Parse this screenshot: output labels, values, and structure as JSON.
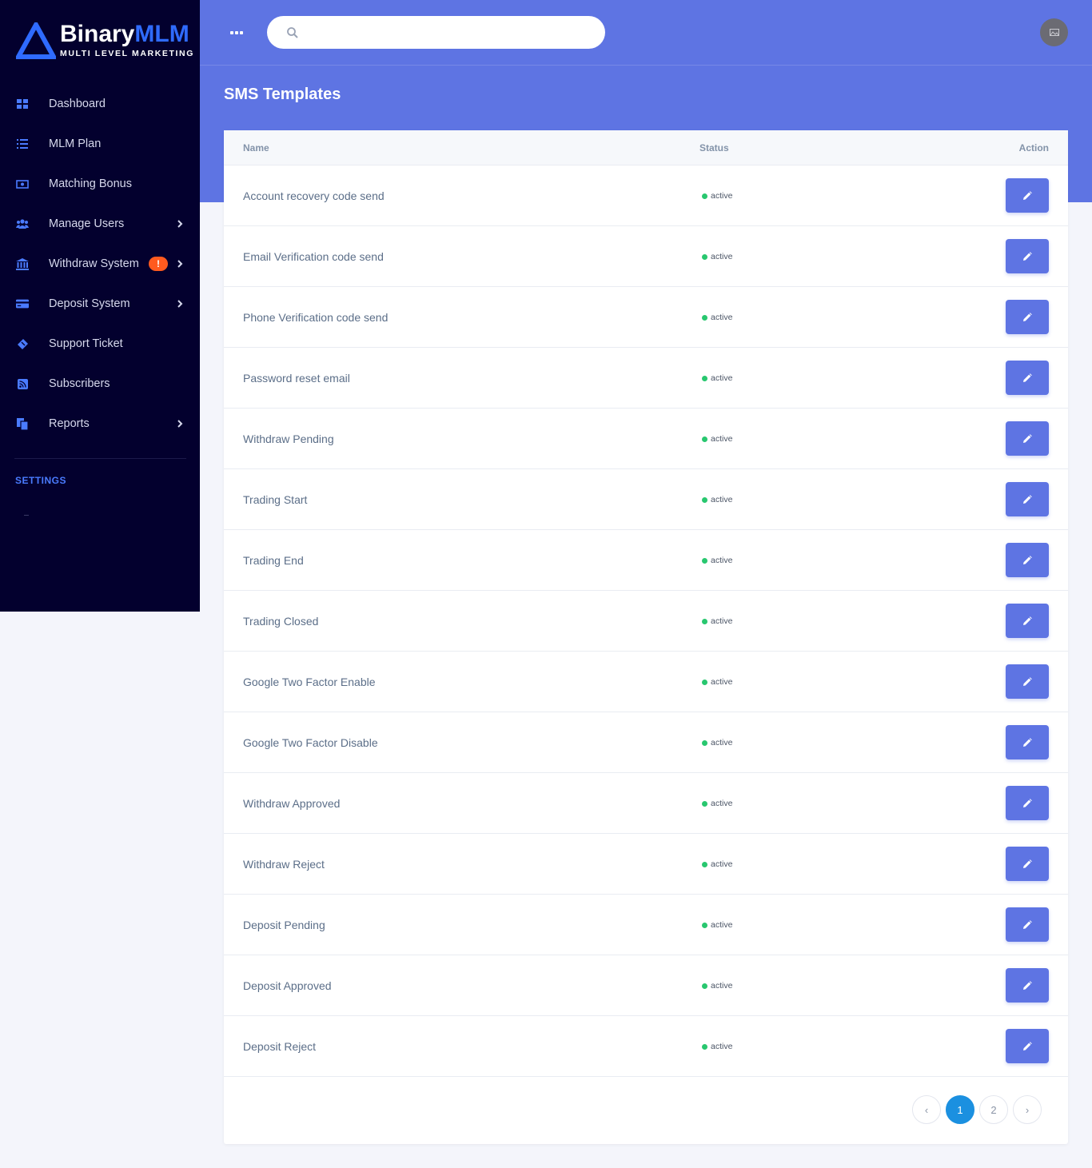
{
  "brand": {
    "name_part1": "Binary",
    "name_part2": "MLM",
    "tagline": "MULTI LEVEL MARKETING",
    "accent": "#2f6bff"
  },
  "sidebar": {
    "items": [
      {
        "label": "Dashboard",
        "icon": "grid-icon",
        "has_arrow": false
      },
      {
        "label": "MLM Plan",
        "icon": "list-icon",
        "has_arrow": false
      },
      {
        "label": "Matching Bonus",
        "icon": "money-icon",
        "has_arrow": false
      },
      {
        "label": "Manage Users",
        "icon": "users-icon",
        "has_arrow": true
      },
      {
        "label": "Withdraw System",
        "icon": "bank-icon",
        "has_arrow": true,
        "badge": "!"
      },
      {
        "label": "Deposit System",
        "icon": "credit-card-icon",
        "has_arrow": true
      },
      {
        "label": "Support Ticket",
        "icon": "ticket-icon",
        "has_arrow": false
      },
      {
        "label": "Subscribers",
        "icon": "rss-icon",
        "has_arrow": false
      },
      {
        "label": "Reports",
        "icon": "copy-icon",
        "has_arrow": true
      }
    ],
    "settings_label": "SETTINGS"
  },
  "header": {
    "search_placeholder": "",
    "search_value": ""
  },
  "page": {
    "title": "SMS Templates"
  },
  "table": {
    "columns": {
      "name": "Name",
      "status": "Status",
      "action": "Action"
    },
    "rows": [
      {
        "name": "Account recovery code send",
        "status": "active"
      },
      {
        "name": "Email Verification code send",
        "status": "active"
      },
      {
        "name": "Phone Verification code send",
        "status": "active"
      },
      {
        "name": "Password reset email",
        "status": "active"
      },
      {
        "name": "Withdraw Pending",
        "status": "active"
      },
      {
        "name": "Trading Start",
        "status": "active"
      },
      {
        "name": "Trading End",
        "status": "active"
      },
      {
        "name": "Trading Closed",
        "status": "active"
      },
      {
        "name": "Google Two Factor Enable",
        "status": "active"
      },
      {
        "name": "Google Two Factor Disable",
        "status": "active"
      },
      {
        "name": "Withdraw Approved",
        "status": "active"
      },
      {
        "name": "Withdraw Reject",
        "status": "active"
      },
      {
        "name": "Deposit Pending",
        "status": "active"
      },
      {
        "name": "Deposit Approved",
        "status": "active"
      },
      {
        "name": "Deposit Reject",
        "status": "active"
      }
    ]
  },
  "pagination": {
    "prev": "‹",
    "pages": [
      "1",
      "2"
    ],
    "current": "1",
    "next": "›"
  },
  "colors": {
    "primary": "#5e74e3",
    "sidebar_bg": "#03002e",
    "active_dot": "#28c76f",
    "badge": "#ff5a1f",
    "page_active": "#1b90e0"
  }
}
